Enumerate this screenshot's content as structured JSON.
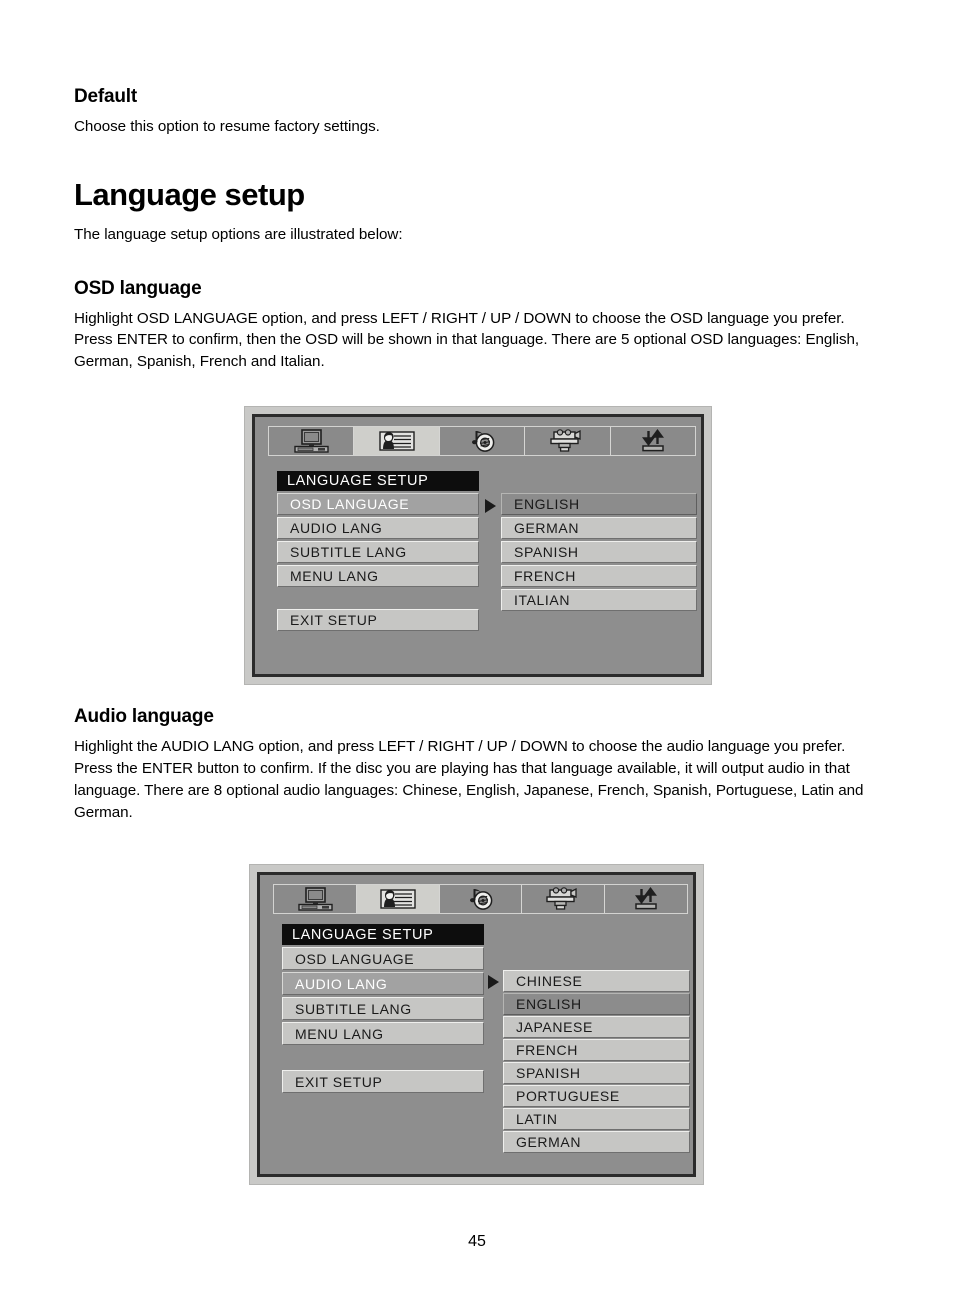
{
  "document": {
    "page_number": "45",
    "sections": [
      {
        "heading": "Default",
        "paragraphs": [
          "Choose this option to resume factory settings."
        ]
      },
      {
        "heading": "Language setup",
        "paragraphs": [
          "The language setup options are illustrated below:"
        ]
      },
      {
        "heading": "OSD language",
        "paragraphs": [
          "Highlight OSD LANGUAGE option, and press LEFT / RIGHT / UP / DOWN to choose the OSD language you prefer. Press ENTER to confirm, then the OSD will be shown in that language. There are 5 optional OSD languages: English, German, Spanish, French and Italian."
        ]
      },
      {
        "heading": "Audio language",
        "paragraphs": [
          "Highlight the AUDIO LANG option, and press LEFT / RIGHT / UP / DOWN to choose the audio language you prefer. Press the ENTER button to confirm. If the disc you are playing has that language available, it will output audio in that language. There are 8 optional audio languages: Chinese, English, Japanese, French, Spanish, Portuguese, Latin and German."
        ]
      }
    ]
  },
  "osd_screens": [
    {
      "id": "osd-language-screen",
      "tabs": [
        {
          "icon": "monitor-icon",
          "active": false
        },
        {
          "icon": "language-person-icon",
          "active": true
        },
        {
          "icon": "audio-disc-icon",
          "active": false
        },
        {
          "icon": "camcorder-icon",
          "active": false
        },
        {
          "icon": "updown-arrows-icon",
          "active": false
        }
      ],
      "menu_title": "LANGUAGE SETUP",
      "menu_items": [
        {
          "label": "OSD LANGUAGE",
          "selected": true
        },
        {
          "label": "AUDIO LANG",
          "selected": false
        },
        {
          "label": "SUBTITLE LANG",
          "selected": false
        },
        {
          "label": "MENU LANG",
          "selected": false
        }
      ],
      "exit_label": "EXIT SETUP",
      "options": [
        {
          "label": "ENGLISH",
          "selected": true
        },
        {
          "label": "GERMAN",
          "selected": false
        },
        {
          "label": "SPANISH",
          "selected": false
        },
        {
          "label": "FRENCH",
          "selected": false
        },
        {
          "label": "ITALIAN",
          "selected": false
        }
      ]
    },
    {
      "id": "audio-language-screen",
      "tabs": [
        {
          "icon": "monitor-icon",
          "active": false
        },
        {
          "icon": "language-person-icon",
          "active": true
        },
        {
          "icon": "audio-disc-icon",
          "active": false
        },
        {
          "icon": "camcorder-icon",
          "active": false
        },
        {
          "icon": "updown-arrows-icon",
          "active": false
        }
      ],
      "menu_title": "LANGUAGE SETUP",
      "menu_items": [
        {
          "label": "OSD LANGUAGE",
          "selected": false
        },
        {
          "label": "AUDIO LANG",
          "selected": true
        },
        {
          "label": "SUBTITLE LANG",
          "selected": false
        },
        {
          "label": "MENU LANG",
          "selected": false
        }
      ],
      "exit_label": "EXIT SETUP",
      "options": [
        {
          "label": "CHINESE",
          "selected": false
        },
        {
          "label": "ENGLISH",
          "selected": true
        },
        {
          "label": "JAPANESE",
          "selected": false
        },
        {
          "label": "FRENCH",
          "selected": false
        },
        {
          "label": "SPANISH",
          "selected": false
        },
        {
          "label": "PORTUGUESE",
          "selected": false
        },
        {
          "label": "LATIN",
          "selected": false
        },
        {
          "label": "GERMAN",
          "selected": false
        }
      ]
    }
  ],
  "colors": {
    "osd_background": "#8e8e8e",
    "osd_frame": "#c9c9c7",
    "menu_item": "#c6c6c4",
    "menu_selected": "#a2a2a2",
    "option_selected": "#8c8c8c",
    "title_bar": "#0d0d0d",
    "tab_active": "#cfcfcb",
    "tab_inactive": "#8a8a8a"
  }
}
